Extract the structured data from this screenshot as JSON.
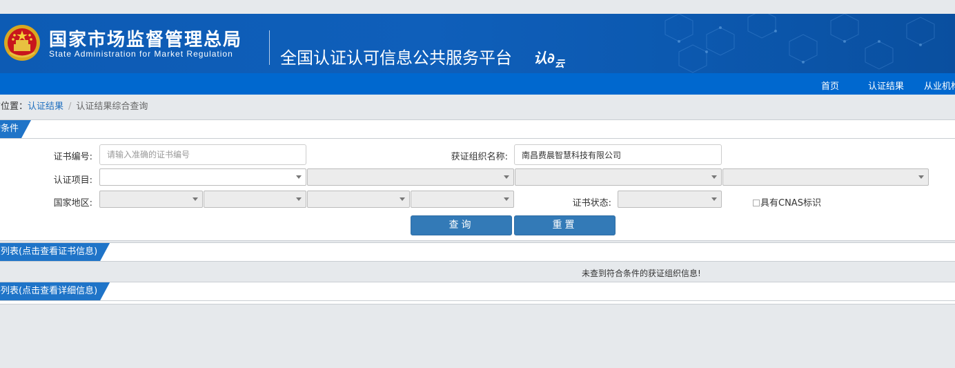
{
  "header": {
    "agency_cn": "国家市场监督管理总局",
    "agency_en": "State Administration  for  Market Regulation",
    "platform": "全国认证认可信息公共服务平台",
    "logo_a": "认",
    "logo_b": "云"
  },
  "nav": [
    "首页",
    "认证结果",
    "从业机构"
  ],
  "breadcrumb": {
    "prefix": "前位置：",
    "link": "认证结果",
    "sep": "/",
    "current": "认证结果综合查询"
  },
  "query": {
    "section_title": "询条件",
    "cert_no_label": "证书编号:",
    "cert_no_placeholder": "请输入准确的证书编号",
    "org_label": "获证组织名称:",
    "org_value": "南昌费晨智慧科技有限公司",
    "project_label": "认证项目:",
    "region_label": "国家地区:",
    "status_label": "证书状态:",
    "cnas_label": "具有CNAS标识",
    "search_button": "查询",
    "reset_button": "重置"
  },
  "org_list": {
    "title": "识列表(点击查看证书信息)",
    "empty_message": "未查到符合条件的获证组织信息!"
  },
  "cert_list": {
    "title": "书列表(点击查看详细信息)"
  },
  "colors": {
    "banner": "#0d5bb4",
    "navbar": "#0068cf",
    "tab": "#1f74c8",
    "button": "#337ab7",
    "link": "#1f6fbf"
  }
}
